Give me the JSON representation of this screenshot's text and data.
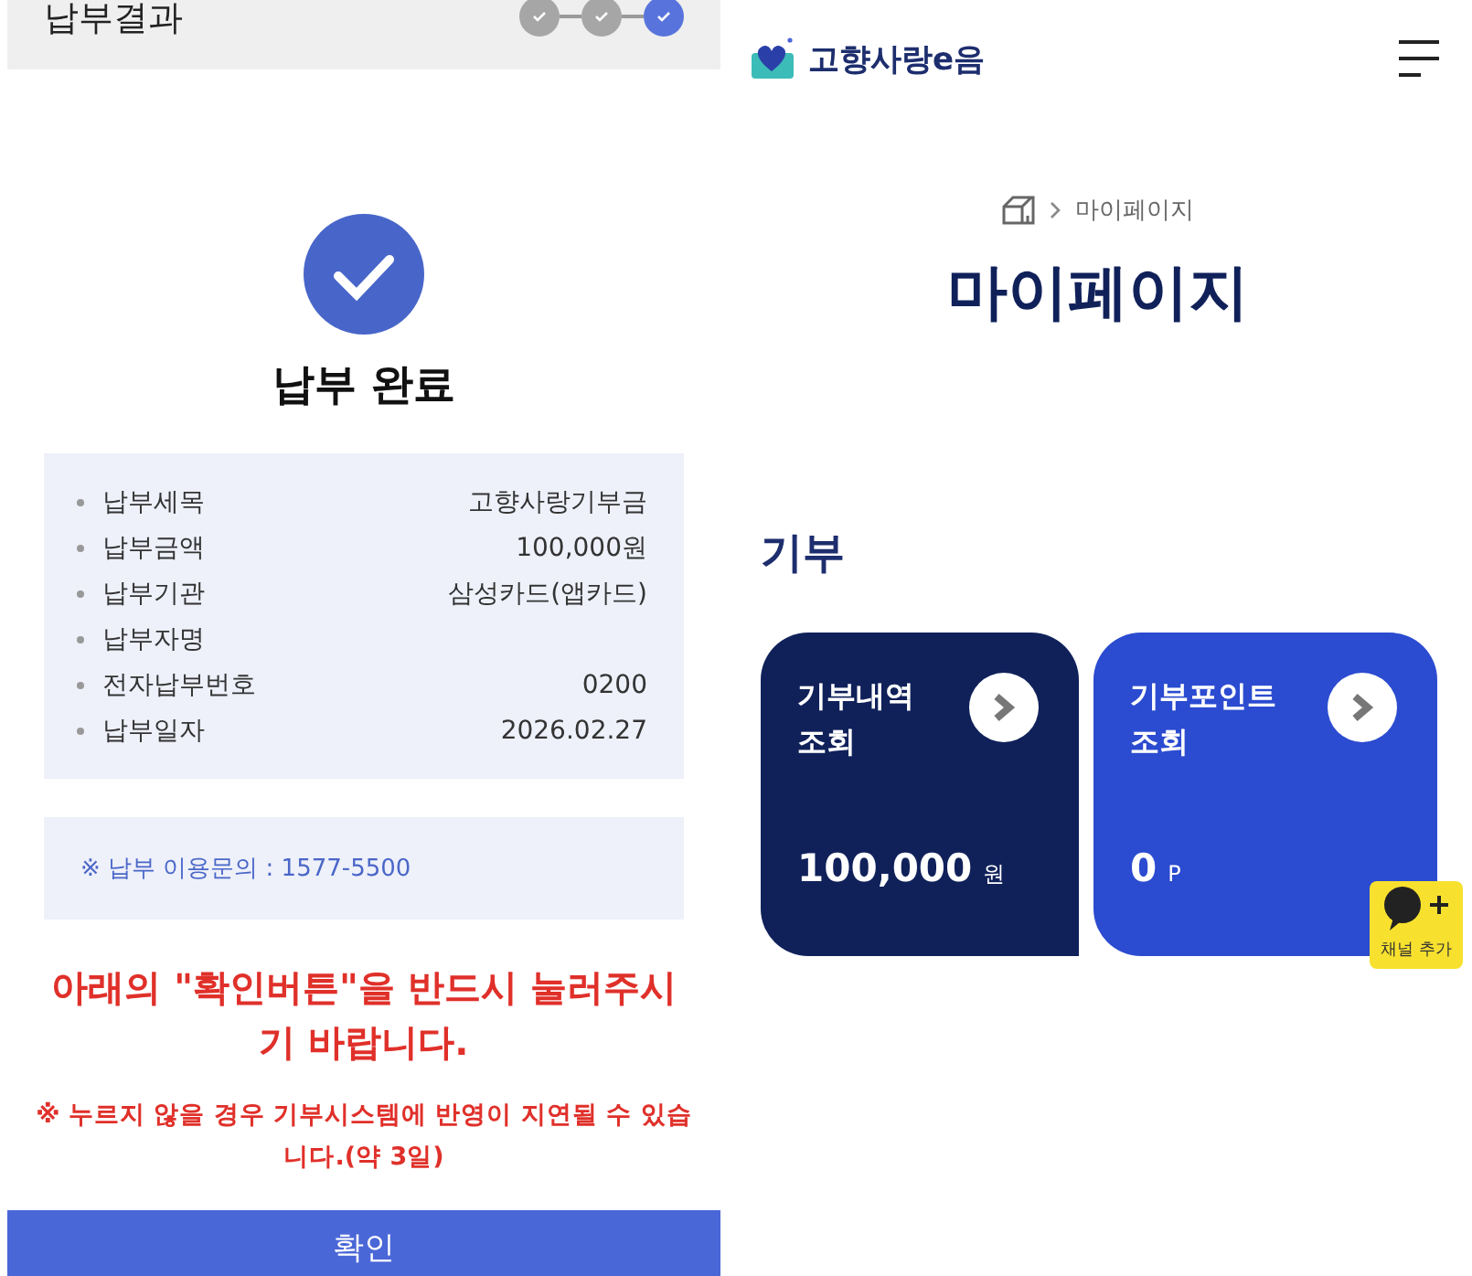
{
  "payment_result": {
    "header_title": "납부결과",
    "steps": [
      {
        "selected": false
      },
      {
        "selected": false
      },
      {
        "selected": true
      }
    ],
    "status_title": "납부 완료",
    "details": [
      {
        "label": "납부세목",
        "value": "고향사랑기부금"
      },
      {
        "label": "납부금액",
        "value": "100,000원"
      },
      {
        "label": "납부기관",
        "value": "삼성카드(앱카드)"
      },
      {
        "label": "납부자명"
      },
      {
        "label": "전자납부번호",
        "value": "0200"
      },
      {
        "label": "납부일자",
        "value": "2026.02.27"
      }
    ],
    "inquiry": "※ 납부 이용문의 : 1577-5500",
    "warning": "아래의 \"확인버튼\"을 반드시 눌러주시기 바랍니다.",
    "notice": "※ 누르지 않을 경우 기부시스템에 반영이 지연될 수 있습니다.(약 3일)",
    "confirm_button": "확인"
  },
  "my_page": {
    "logo": "고향사랑e음",
    "breadcrumb": "마이페이지",
    "title": "마이페이지",
    "section_title": "기부",
    "cards": [
      {
        "title": "기부내역 조회",
        "amount": "100,000",
        "unit": "원",
        "color": "#10215a"
      },
      {
        "title": "기부포인트 조회",
        "amount": "0",
        "unit": "P",
        "color": "#2b4bd0"
      }
    ],
    "channel_button": "채널 추가"
  }
}
